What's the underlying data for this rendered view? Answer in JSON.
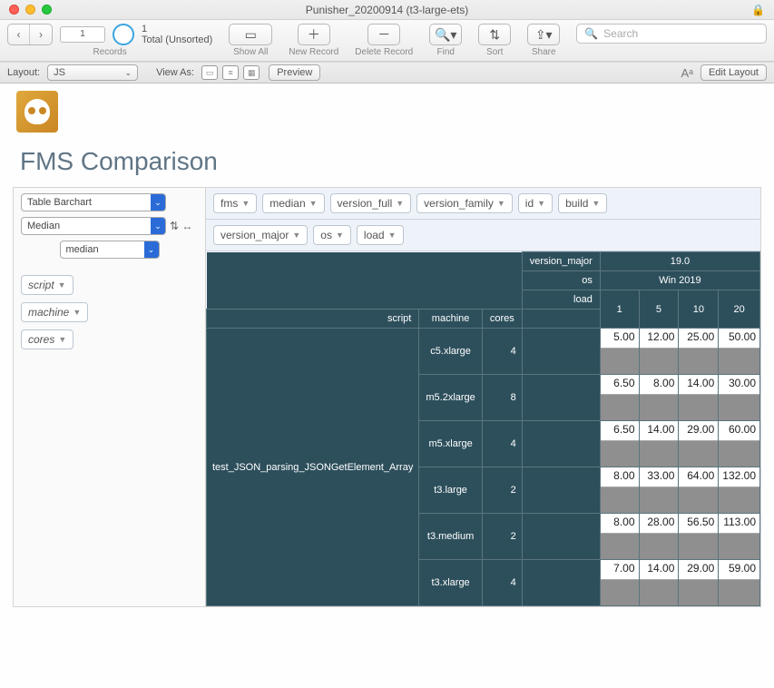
{
  "window": {
    "title": "Punisher_20200914 (t3-large-ets)"
  },
  "toolbar": {
    "record_box": "1",
    "record_count": "1",
    "record_status": "Total (Unsorted)",
    "labels": {
      "records": "Records",
      "showall": "Show All",
      "newrecord": "New Record",
      "deleterecord": "Delete Record",
      "find": "Find",
      "sort": "Sort",
      "share": "Share"
    },
    "search_placeholder": "Search"
  },
  "status": {
    "layout_label": "Layout:",
    "layout_value": "JS",
    "viewas_label": "View As:",
    "preview": "Preview",
    "editlayout": "Edit Layout"
  },
  "page": {
    "heading": "FMS Comparison"
  },
  "left": {
    "chart_dropdown": "Table Barchart",
    "agg_dropdown": "Median",
    "metric_dropdown": "median",
    "filters": [
      "script",
      "machine",
      "cores"
    ]
  },
  "pills_row1": [
    "fms",
    "median",
    "version_full",
    "version_family",
    "id",
    "build"
  ],
  "pills_row2": [
    "version_major",
    "os",
    "load"
  ],
  "table": {
    "col_labels": {
      "version_major": "version_major",
      "os": "os",
      "load": "load",
      "script": "script",
      "machine": "machine",
      "cores": "cores"
    },
    "version_major": "19.0",
    "os": "Win 2019",
    "loads": [
      "1",
      "5",
      "10",
      "20"
    ],
    "script": "test_JSON_parsing_JSONGetElement_Array",
    "rows": [
      {
        "machine": "c5.xlarge",
        "cores": "4",
        "vals": [
          "5.00",
          "12.00",
          "25.00",
          "50.00"
        ]
      },
      {
        "machine": "m5.2xlarge",
        "cores": "8",
        "vals": [
          "6.50",
          "8.00",
          "14.00",
          "30.00"
        ]
      },
      {
        "machine": "m5.xlarge",
        "cores": "4",
        "vals": [
          "6.50",
          "14.00",
          "29.00",
          "60.00"
        ]
      },
      {
        "machine": "t3.large",
        "cores": "2",
        "vals": [
          "8.00",
          "33.00",
          "64.00",
          "132.00"
        ]
      },
      {
        "machine": "t3.medium",
        "cores": "2",
        "vals": [
          "8.00",
          "28.00",
          "56.50",
          "113.00"
        ]
      },
      {
        "machine": "t3.xlarge",
        "cores": "4",
        "vals": [
          "7.00",
          "14.00",
          "29.00",
          "59.00"
        ]
      }
    ]
  },
  "chart_data": {
    "type": "table",
    "title": "FMS Comparison",
    "xlabel": "load",
    "ylabel": "median",
    "version_major": "19.0",
    "os": "Win 2019",
    "script": "test_JSON_parsing_JSONGetElement_Array",
    "categories": [
      "1",
      "5",
      "10",
      "20"
    ],
    "series": [
      {
        "name": "c5.xlarge",
        "cores": 4,
        "values": [
          5.0,
          12.0,
          25.0,
          50.0
        ]
      },
      {
        "name": "m5.2xlarge",
        "cores": 8,
        "values": [
          6.5,
          8.0,
          14.0,
          30.0
        ]
      },
      {
        "name": "m5.xlarge",
        "cores": 4,
        "values": [
          6.5,
          14.0,
          29.0,
          60.0
        ]
      },
      {
        "name": "t3.large",
        "cores": 2,
        "values": [
          8.0,
          33.0,
          64.0,
          132.0
        ]
      },
      {
        "name": "t3.medium",
        "cores": 2,
        "values": [
          8.0,
          28.0,
          56.5,
          113.0
        ]
      },
      {
        "name": "t3.xlarge",
        "cores": 4,
        "values": [
          7.0,
          14.0,
          29.0,
          59.0
        ]
      }
    ]
  }
}
